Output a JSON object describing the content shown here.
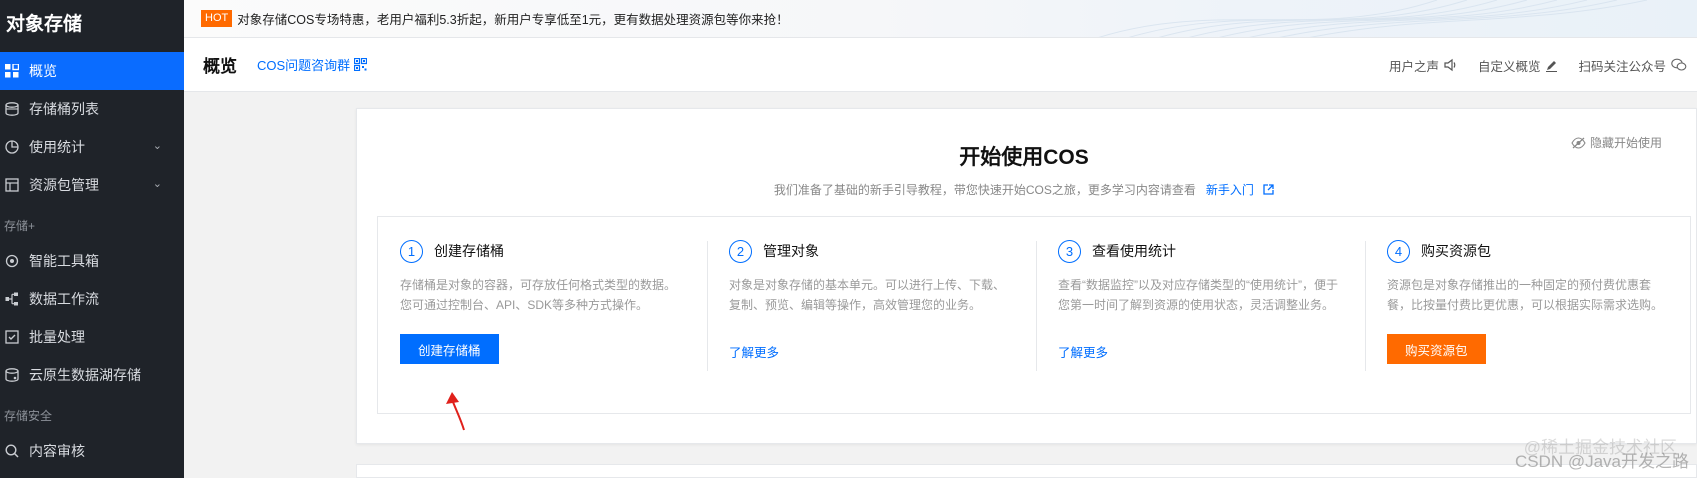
{
  "sidebar": {
    "title": "对象存储",
    "items": [
      {
        "label": "概览",
        "icon": "grid-icon",
        "active": true
      },
      {
        "label": "存储桶列表",
        "icon": "bucket-icon"
      },
      {
        "label": "使用统计",
        "icon": "pie-chart-icon",
        "has_submenu": true
      },
      {
        "label": "资源包管理",
        "icon": "package-icon",
        "has_submenu": true
      }
    ],
    "group_storage_plus": "存储+",
    "plus_items": [
      {
        "label": "智能工具箱",
        "icon": "toolbox-icon"
      },
      {
        "label": "数据工作流",
        "icon": "workflow-icon"
      },
      {
        "label": "批量处理",
        "icon": "checkbox-icon"
      },
      {
        "label": "云原生数据湖存储",
        "icon": "database-icon"
      }
    ],
    "group_security": "存储安全",
    "security_items": [
      {
        "label": "内容审核",
        "icon": "search-icon"
      }
    ],
    "chevron": "⌄"
  },
  "banner": {
    "badge": "HOT",
    "text": "对象存储COS专场特惠，老用户福利5.3折起，新用户专享低至1元，更有数据处理资源包等你来抢！"
  },
  "header": {
    "title": "概览",
    "qa_link": "COS问题咨询群",
    "right_items": [
      {
        "label": "用户之声",
        "icon": "speaker-icon"
      },
      {
        "label": "自定义概览",
        "icon": "pencil-icon"
      },
      {
        "label": "扫码关注公众号",
        "icon": "wechat-icon"
      }
    ]
  },
  "card": {
    "title": "开始使用COS",
    "subtitle": "我们准备了基础的新手引导教程，带您快速开始COS之旅，更多学习内容请查看",
    "subtitle_link": "新手入门",
    "hide_label": "隐藏开始使用",
    "steps": [
      {
        "num": "1",
        "name": "创建存储桶",
        "desc": "存储桶是对象的容器，可存放任何格式类型的数据。您可通过控制台、API、SDK等多种方式操作。",
        "action": "创建存储桶",
        "action_type": "button-blue"
      },
      {
        "num": "2",
        "name": "管理对象",
        "desc": "对象是对象存储的基本单元。可以进行上传、下载、复制、预览、编辑等操作，高效管理您的业务。",
        "action": "了解更多",
        "action_type": "link"
      },
      {
        "num": "3",
        "name": "查看使用统计",
        "desc": "查看“数据监控”以及对应存储类型的“使用统计”，便于您第一时间了解到资源的使用状态，灵活调整业务。",
        "action": "了解更多",
        "action_type": "link"
      },
      {
        "num": "4",
        "name": "购买资源包",
        "desc": "资源包是对象存储推出的一种固定的预付费优惠套餐，比按量付费比更优惠，可以根据实际需求选购。",
        "action": "购买资源包",
        "action_type": "button-orange"
      }
    ]
  },
  "watermark": {
    "line1": "@稀土掘金技术社区",
    "line2": "CSDN @Java开发之路"
  },
  "colors": {
    "sidebar_bg": "#1f2329",
    "active": "#0a6cff",
    "link": "#006eff",
    "orange": "#ff6a00"
  }
}
